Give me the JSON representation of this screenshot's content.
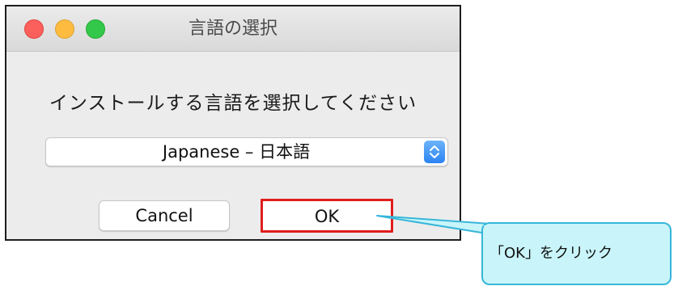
{
  "window": {
    "title": "言語の選択",
    "controls": [
      "close-icon",
      "minimize-icon",
      "zoom-icon"
    ]
  },
  "dialog": {
    "prompt": "インストールする言語を選択してください",
    "language_select": {
      "selected_value": "Japanese – 日本語",
      "icon": "chevron-updown-icon"
    },
    "buttons": {
      "cancel_label": "Cancel",
      "ok_label": "OK"
    }
  },
  "callout": {
    "text": "「OK」をクリック"
  },
  "colors": {
    "highlight_border": "#e01e1e",
    "callout_fill": "#c9f5fa",
    "callout_border": "#37b6d9",
    "select_accent": "#2b84f3"
  }
}
